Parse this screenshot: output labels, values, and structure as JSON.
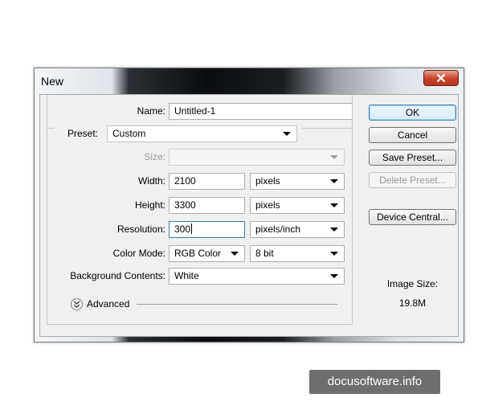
{
  "dialog": {
    "title": "New",
    "name_label": "Name:",
    "name_value": "Untitled-1",
    "preset_label": "Preset:",
    "preset_value": "Custom",
    "size_label": "Size:",
    "size_value": "",
    "width_label": "Width:",
    "width_value": "2100",
    "width_unit": "pixels",
    "height_label": "Height:",
    "height_value": "3300",
    "height_unit": "pixels",
    "resolution_label": "Resolution:",
    "resolution_value": "300",
    "resolution_unit": "pixels/inch",
    "color_mode_label": "Color Mode:",
    "color_mode_value": "RGB Color",
    "bit_depth_value": "8 bit",
    "background_label": "Background Contents:",
    "background_value": "White",
    "advanced_label": "Advanced"
  },
  "buttons": {
    "ok": "OK",
    "cancel": "Cancel",
    "save_preset": "Save Preset...",
    "delete_preset": "Delete Preset...",
    "device_central": "Device Central..."
  },
  "image_size": {
    "label": "Image Size:",
    "value": "19.8M"
  },
  "watermark": "docusoftware.info",
  "icons": {
    "close": "close-icon",
    "dropdown": "chevron-down-icon",
    "advanced": "double-chevron-down-icon"
  },
  "colors": {
    "default_button_border": "#3c7fb1",
    "close_button": "#c6412a"
  }
}
